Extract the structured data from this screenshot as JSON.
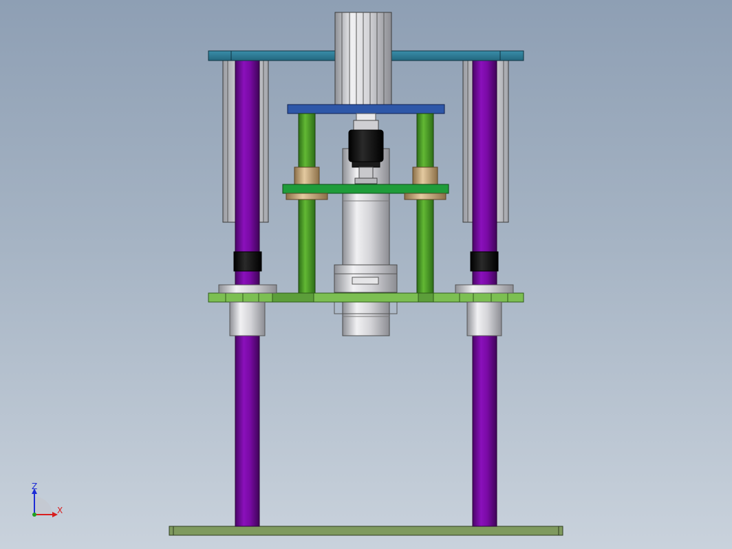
{
  "viewport": {
    "background_top": "#8e9fb4",
    "background_bottom": "#c9d2dc"
  },
  "model": {
    "parts": [
      {
        "name": "top-plate",
        "color": "#2f7f98"
      },
      {
        "name": "guide-column",
        "color": "#7a0aa6"
      },
      {
        "name": "linear-rail",
        "color": "#c9ccd3"
      },
      {
        "name": "upper-plate",
        "color": "#2e57a8"
      },
      {
        "name": "green-guide-rod",
        "color": "#4fa02a"
      },
      {
        "name": "moving-plate",
        "color": "#1f9c3a"
      },
      {
        "name": "bushing",
        "color": "#c8a77a"
      },
      {
        "name": "clamp-jaw",
        "color": "#111111"
      },
      {
        "name": "cylinder-body",
        "color": "#d8d8dc"
      },
      {
        "name": "middle-plate",
        "color": "#7cbf52"
      },
      {
        "name": "linear-bearing",
        "color": "#d8d8d8"
      },
      {
        "name": "base-plate",
        "color": "#7f9a5e"
      }
    ]
  },
  "triad": {
    "z_label": "Z",
    "x_label": "X",
    "z_color": "#1c2bd6",
    "x_color": "#d81e1e",
    "y_color": "#20a020"
  }
}
